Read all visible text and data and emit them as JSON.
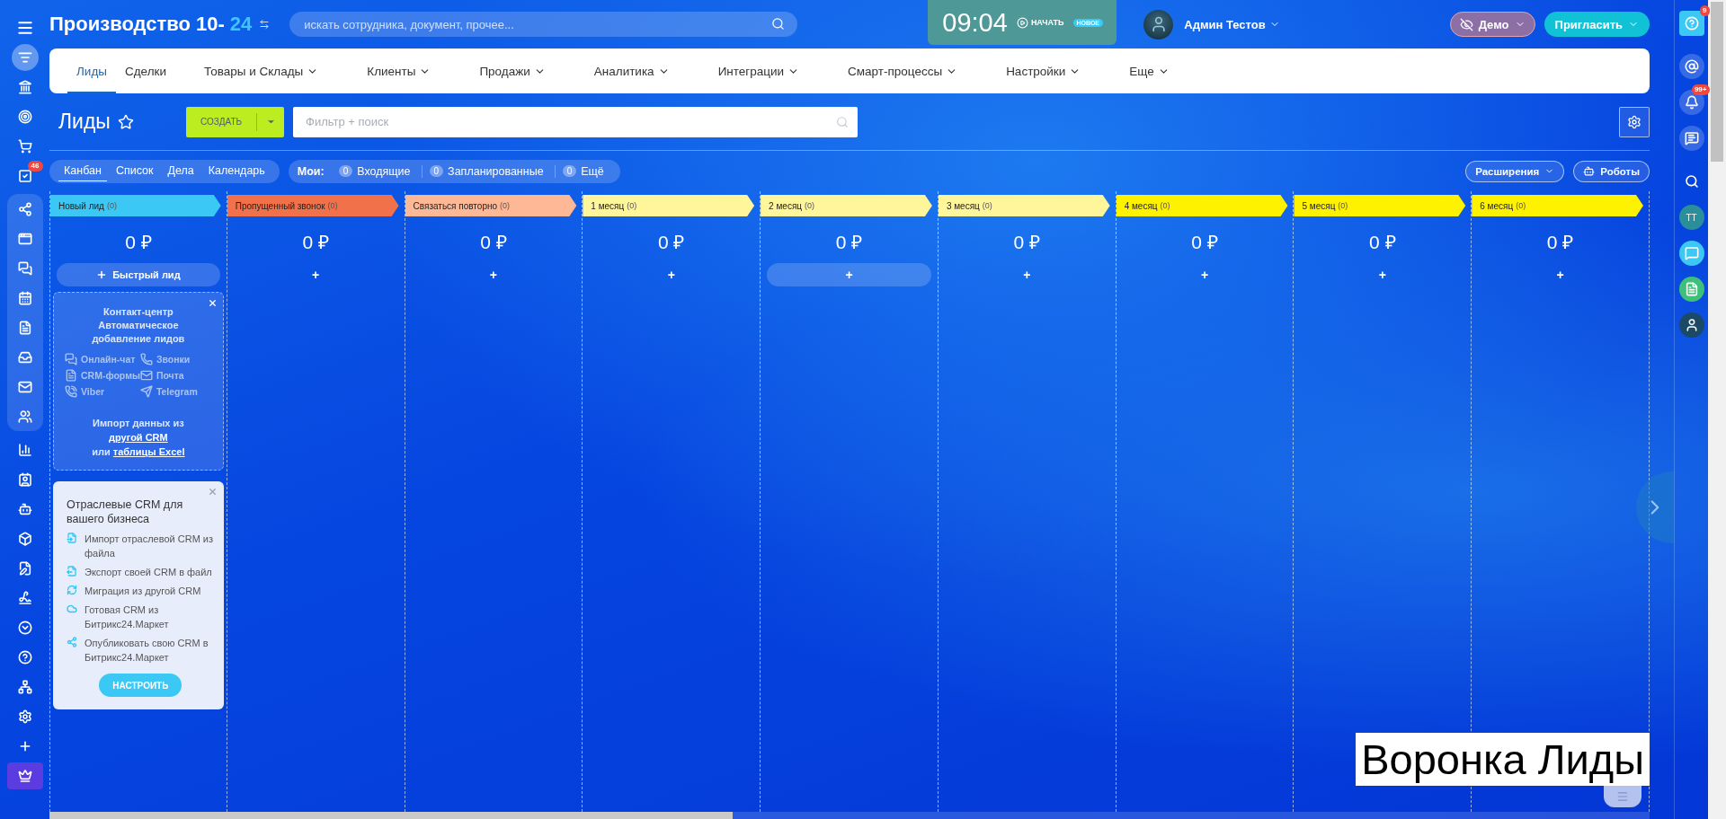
{
  "header": {
    "title": "Производство 10-",
    "title_accent": "24",
    "search_placeholder": "искать сотрудника, документ, прочее...",
    "clock": "09:04",
    "start": "НАЧАТЬ",
    "start_badge": "НОВОЕ",
    "user": "Админ Тестов",
    "demo": "Демо",
    "invite": "Пригласить"
  },
  "nav": {
    "tabs": [
      {
        "label": "Лиды",
        "selected": true,
        "dropdown": false
      },
      {
        "label": "Сделки",
        "selected": false,
        "dropdown": false
      },
      {
        "label": "Товары и Склады",
        "selected": false,
        "dropdown": true
      },
      {
        "label": "Клиенты",
        "selected": false,
        "dropdown": true
      },
      {
        "label": "Продажи",
        "selected": false,
        "dropdown": true
      },
      {
        "label": "Аналитика",
        "selected": false,
        "dropdown": true
      },
      {
        "label": "Интеграции",
        "selected": false,
        "dropdown": true
      },
      {
        "label": "Смарт-процессы",
        "selected": false,
        "dropdown": true
      },
      {
        "label": "Настройки",
        "selected": false,
        "dropdown": true
      },
      {
        "label": "Еще",
        "selected": false,
        "dropdown": true
      }
    ]
  },
  "page": {
    "title": "Лиды",
    "create": "СОЗДАТЬ",
    "filter_placeholder": "Фильтр + поиск"
  },
  "views": [
    {
      "label": "Канбан",
      "selected": true
    },
    {
      "label": "Список",
      "selected": false
    },
    {
      "label": "Дела",
      "selected": false
    },
    {
      "label": "Календарь",
      "selected": false
    }
  ],
  "counters": {
    "label": "Мои:",
    "items": [
      {
        "count": "0",
        "label": "Входящие"
      },
      {
        "count": "0",
        "label": "Запланированные"
      },
      {
        "count": "0",
        "label": "Ещё"
      }
    ]
  },
  "extensions": "Расширения",
  "robots": "Роботы",
  "columns": [
    {
      "title": "Новый лид",
      "count": "(0)",
      "color": "#3bc8f5",
      "total": "0 ₽",
      "add": {
        "kind": "quick",
        "label": "Быстрый лид",
        "highlighted": true
      }
    },
    {
      "title": "Пропущенный звонок",
      "count": "(0)",
      "color": "#f1724a",
      "total": "0 ₽",
      "add": {
        "kind": "plus",
        "label": "+",
        "highlighted": false
      }
    },
    {
      "title": "Связаться повторно",
      "count": "(0)",
      "color": "#ffb896",
      "total": "0 ₽",
      "add": {
        "kind": "plus",
        "label": "+",
        "highlighted": false
      }
    },
    {
      "title": "1 месяц",
      "count": "(0)",
      "color": "#fff59b",
      "total": "0 ₽",
      "add": {
        "kind": "plus",
        "label": "+",
        "highlighted": false
      }
    },
    {
      "title": "2 месяц",
      "count": "(0)",
      "color": "#fff59b",
      "total": "0 ₽",
      "add": {
        "kind": "plus",
        "label": "+",
        "highlighted": true
      }
    },
    {
      "title": "3 месяц",
      "count": "(0)",
      "color": "#fff59b",
      "total": "0 ₽",
      "add": {
        "kind": "plus",
        "label": "+",
        "highlighted": false
      }
    },
    {
      "title": "4 месяц",
      "count": "(0)",
      "color": "#fff200",
      "total": "0 ₽",
      "add": {
        "kind": "plus",
        "label": "+",
        "highlighted": false
      }
    },
    {
      "title": "5 месяц",
      "count": "(0)",
      "color": "#fff200",
      "total": "0 ₽",
      "add": {
        "kind": "plus",
        "label": "+",
        "highlighted": false
      }
    },
    {
      "title": "6 месяц",
      "count": "(0)",
      "color": "#fff200",
      "total": "0 ₽",
      "add": {
        "kind": "plus",
        "label": "+",
        "highlighted": false
      }
    }
  ],
  "contact_card": {
    "title": "Контакт-центр Автоматическое добавление лидов",
    "channels": [
      {
        "kind": "chat",
        "label": "Онлайн-чат"
      },
      {
        "kind": "phone",
        "label": "Звонки"
      },
      {
        "kind": "form",
        "label": "CRM-формы"
      },
      {
        "kind": "mail",
        "label": "Почта"
      },
      {
        "kind": "viber",
        "label": "Viber"
      },
      {
        "kind": "telegram",
        "label": "Telegram"
      }
    ],
    "import_text": "Импорт данных из",
    "import_link": "другой CRM",
    "or_text": "или",
    "excel_link": "таблицы Excel"
  },
  "industry_card": {
    "title": "Отраслевые CRM для вашего бизнеса",
    "items": [
      {
        "kind": "import",
        "label": "Импорт отраслевой CRM из файла"
      },
      {
        "kind": "export",
        "label": "Экспорт своей CRM в файл"
      },
      {
        "kind": "migrate",
        "label": "Миграция из другой CRM"
      },
      {
        "kind": "cloud",
        "label": "Готовая CRM из Битрикс24.Маркет"
      },
      {
        "kind": "share",
        "label": "Опубликовать свою CRM в Битрикс24.Маркет"
      }
    ],
    "button": "НАСТРОИТЬ"
  },
  "left_sidebar": [
    {
      "kind": "menu",
      "selected": false,
      "grouped": false
    },
    {
      "kind": "filter",
      "selected": true,
      "grouped": false
    },
    {
      "kind": "bank",
      "selected": false,
      "grouped": false
    },
    {
      "kind": "target",
      "selected": false,
      "grouped": false
    },
    {
      "kind": "cart",
      "selected": false,
      "grouped": false
    },
    {
      "kind": "tasks",
      "selected": false,
      "grouped": false,
      "badge": "46"
    },
    {
      "kind": "share",
      "selected": false,
      "grouped": true
    },
    {
      "kind": "window",
      "selected": false,
      "grouped": true
    },
    {
      "kind": "chat",
      "selected": false,
      "grouped": true
    },
    {
      "kind": "calendar",
      "selected": false,
      "grouped": true
    },
    {
      "kind": "doc",
      "selected": false,
      "grouped": true
    },
    {
      "kind": "drive",
      "selected": false,
      "grouped": true
    },
    {
      "kind": "mail",
      "selected": false,
      "grouped": true
    },
    {
      "kind": "people",
      "selected": false,
      "grouped": true
    },
    {
      "kind": "chart",
      "selected": false,
      "grouped": false
    },
    {
      "kind": "contact",
      "selected": false,
      "grouped": false
    },
    {
      "kind": "robot",
      "selected": false,
      "grouped": false
    },
    {
      "kind": "box",
      "selected": false,
      "grouped": false
    },
    {
      "kind": "edit",
      "selected": false,
      "grouped": false
    },
    {
      "kind": "sign",
      "selected": false,
      "grouped": false
    },
    {
      "kind": "more",
      "selected": false,
      "grouped": false
    },
    {
      "kind": "help",
      "selected": false,
      "grouped": false
    },
    {
      "kind": "tree",
      "selected": false,
      "grouped": false
    },
    {
      "kind": "settings",
      "selected": false,
      "grouped": false
    },
    {
      "kind": "plus",
      "selected": false,
      "grouped": false
    },
    {
      "kind": "crown",
      "selected": false,
      "grouped": false
    }
  ],
  "right_sidebar": [
    {
      "kind": "help",
      "badge": "9"
    },
    {
      "kind": "at"
    },
    {
      "kind": "bell",
      "badge": "99+"
    },
    {
      "kind": "chatsearch"
    },
    {
      "kind": "search"
    },
    {
      "kind": "initials",
      "label": "ТТ"
    },
    {
      "kind": "chat"
    },
    {
      "kind": "doc"
    },
    {
      "kind": "avatar"
    }
  ],
  "caption": "Воронка Лиды"
}
